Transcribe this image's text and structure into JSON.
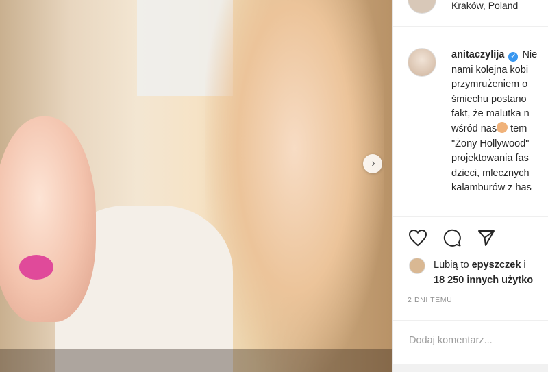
{
  "post": {
    "location": "Kraków, Poland",
    "username": "anitaczylija",
    "caption_lines": [
      "Nie",
      "nami kolejna kobi",
      "przymrużeniem o",
      "śmiechu postano",
      "fakt, że malutka n",
      "wśród nas",
      "tem",
      "\"Żony Hollywood\"",
      "projektowania fas",
      "dzieci, mlecznych",
      "kalamburów z has"
    ],
    "likes_prefix": "Lubią to",
    "likes_user": "epyszczek",
    "likes_conj": "i",
    "likes_count": "18 250 innych użytko",
    "time_ago": "2 DNI TEMU",
    "comment_placeholder": "Dodaj komentarz..."
  },
  "icons": {
    "like": "heart-icon",
    "comment": "speech-bubble-icon",
    "share": "paper-plane-icon",
    "next": "chevron-right-icon",
    "verified": "verified-badge-icon"
  },
  "colors": {
    "verified": "#3897f0",
    "text": "#262626",
    "muted": "#8e8e8e"
  }
}
